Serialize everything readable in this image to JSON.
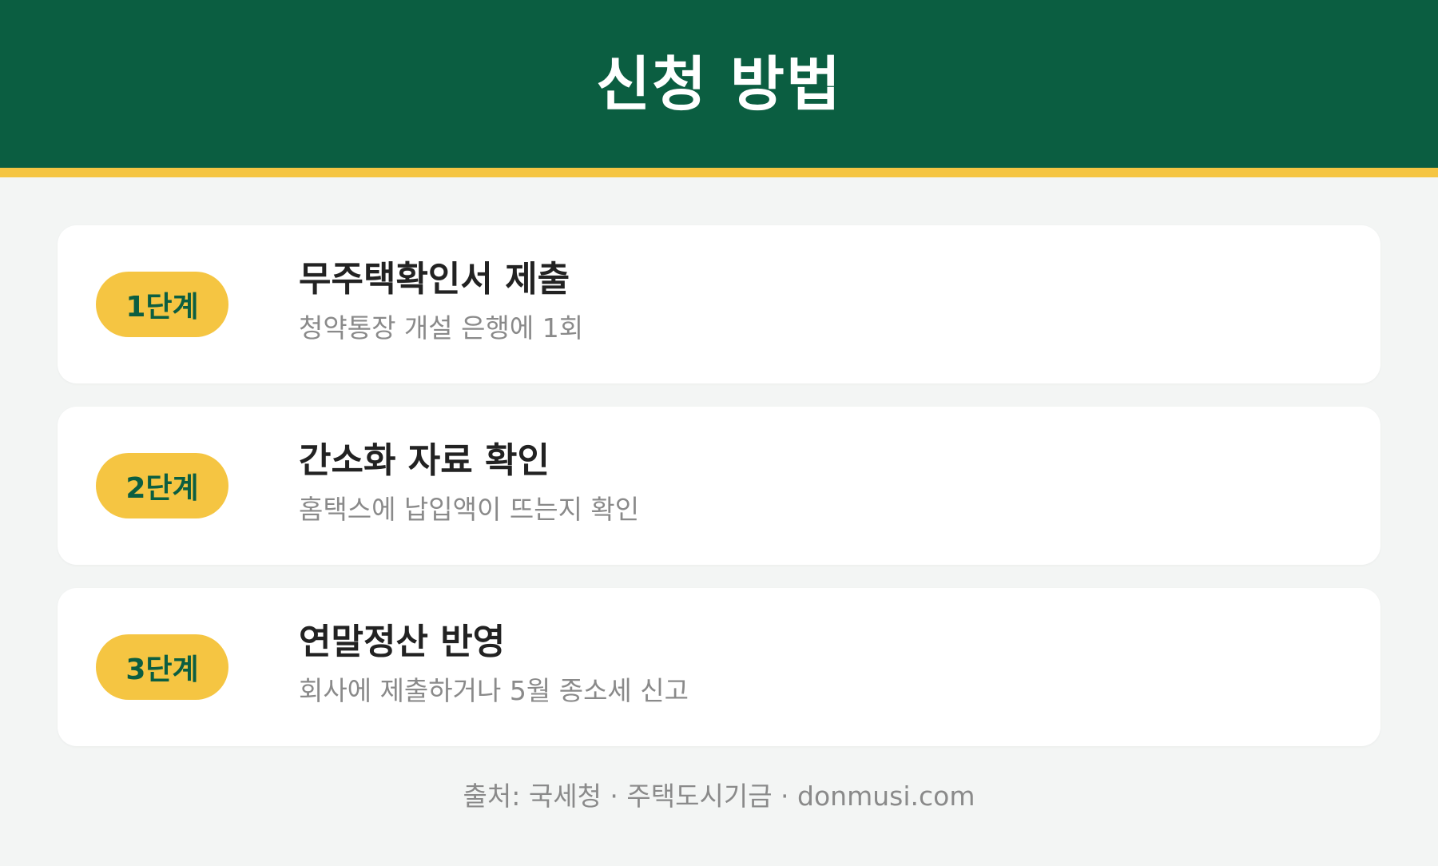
{
  "header": {
    "title": "신청 방법",
    "colors": {
      "background": "#0b5e41",
      "stripe": "#f5c542"
    }
  },
  "steps": [
    {
      "badge": "1단계",
      "title": "무주택확인서 제출",
      "description": "청약통장 개설 은행에 1회"
    },
    {
      "badge": "2단계",
      "title": "간소화 자료 확인",
      "description": "홈택스에 납입액이 뜨는지 확인"
    },
    {
      "badge": "3단계",
      "title": "연말정산 반영",
      "description": "회사에 제출하거나 5월 종소세 신고"
    }
  ],
  "footer": {
    "source": "출처: 국세청 · 주택도시기금 · donmusi.com"
  }
}
